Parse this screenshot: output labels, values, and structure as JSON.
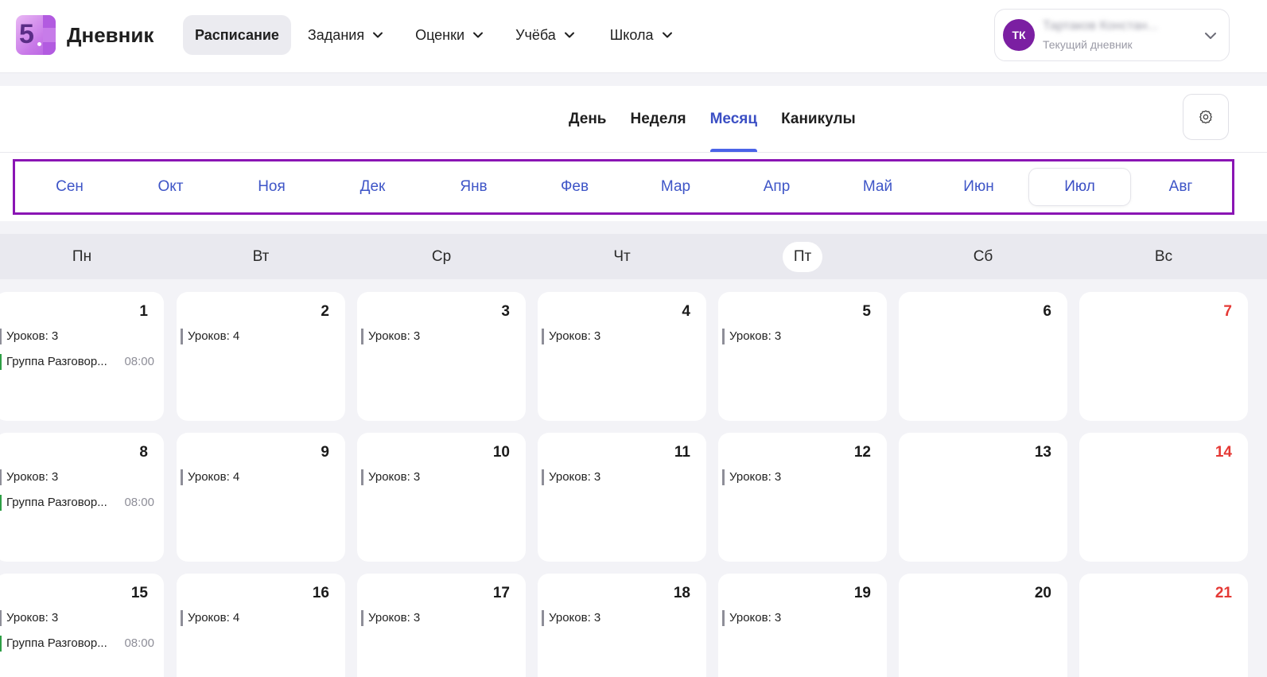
{
  "app": {
    "logo_digit": "5",
    "brand": "Дневник"
  },
  "nav": {
    "items": [
      {
        "label": "Расписание",
        "active": true,
        "dropdown": false
      },
      {
        "label": "Задания",
        "active": false,
        "dropdown": true
      },
      {
        "label": "Оценки",
        "active": false,
        "dropdown": true
      },
      {
        "label": "Учёба",
        "active": false,
        "dropdown": true
      },
      {
        "label": "Школа",
        "active": false,
        "dropdown": true
      }
    ]
  },
  "user": {
    "initials": "ТК",
    "name": "Тартаков Констан...",
    "subtitle": "Текущий дневник",
    "avatar_color": "#7b1fa2"
  },
  "view_tabs": [
    {
      "label": "День",
      "active": false
    },
    {
      "label": "Неделя",
      "active": false
    },
    {
      "label": "Месяц",
      "active": true
    },
    {
      "label": "Каникулы",
      "active": false
    }
  ],
  "settings_icon": "gear-icon",
  "months": [
    {
      "label": "Сен",
      "active": false
    },
    {
      "label": "Окт",
      "active": false
    },
    {
      "label": "Ноя",
      "active": false
    },
    {
      "label": "Дек",
      "active": false
    },
    {
      "label": "Янв",
      "active": false
    },
    {
      "label": "Фев",
      "active": false
    },
    {
      "label": "Мар",
      "active": false
    },
    {
      "label": "Апр",
      "active": false
    },
    {
      "label": "Май",
      "active": false
    },
    {
      "label": "Июн",
      "active": false
    },
    {
      "label": "Июл",
      "active": true
    },
    {
      "label": "Авг",
      "active": false
    }
  ],
  "weekdays": [
    {
      "label": "Пн",
      "today": false
    },
    {
      "label": "Вт",
      "today": false
    },
    {
      "label": "Ср",
      "today": false
    },
    {
      "label": "Чт",
      "today": false
    },
    {
      "label": "Пт",
      "today": true
    },
    {
      "label": "Сб",
      "today": false
    },
    {
      "label": "Вс",
      "today": false
    }
  ],
  "calendar": {
    "weeks": [
      [
        {
          "day": "1",
          "lessons": "Уроков: 3",
          "event": {
            "name": "Группа Разговор...",
            "time": "08:00"
          }
        },
        {
          "day": "2",
          "lessons": "Уроков: 4"
        },
        {
          "day": "3",
          "lessons": "Уроков: 3"
        },
        {
          "day": "4",
          "lessons": "Уроков: 3"
        },
        {
          "day": "5",
          "lessons": "Уроков: 3"
        },
        {
          "day": "6"
        },
        {
          "day": "7",
          "sunday": true
        }
      ],
      [
        {
          "day": "8",
          "lessons": "Уроков: 3",
          "event": {
            "name": "Группа Разговор...",
            "time": "08:00"
          }
        },
        {
          "day": "9",
          "lessons": "Уроков: 4"
        },
        {
          "day": "10",
          "lessons": "Уроков: 3"
        },
        {
          "day": "11",
          "lessons": "Уроков: 3"
        },
        {
          "day": "12",
          "lessons": "Уроков: 3"
        },
        {
          "day": "13"
        },
        {
          "day": "14",
          "sunday": true
        }
      ],
      [
        {
          "day": "15",
          "lessons": "Уроков: 3",
          "event": {
            "name": "Группа Разговор...",
            "time": "08:00"
          }
        },
        {
          "day": "16",
          "lessons": "Уроков: 4"
        },
        {
          "day": "17",
          "lessons": "Уроков: 3"
        },
        {
          "day": "18",
          "lessons": "Уроков: 3"
        },
        {
          "day": "19",
          "lessons": "Уроков: 3"
        },
        {
          "day": "20"
        },
        {
          "day": "21",
          "sunday": true
        }
      ]
    ]
  },
  "colors": {
    "accent": "#3b4fc4",
    "month_highlight_border": "#8a15b4",
    "sunday": "#e53935",
    "lesson_marker": "#8e8e98",
    "event_marker": "#2e9e45"
  }
}
